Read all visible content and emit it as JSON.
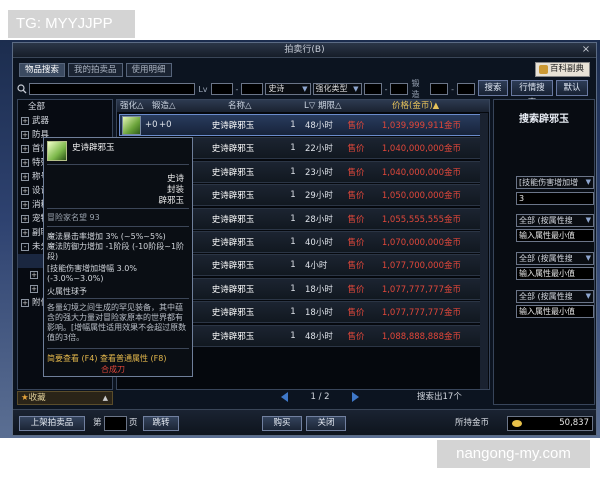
{
  "watermark_top": "TG: MYYJJPP",
  "watermark_bottom": "nangong-my.com",
  "window": {
    "title": "拍卖行(B)",
    "close": "×"
  },
  "tabs": [
    "物品搜索",
    "我的拍卖品",
    "使用明细"
  ],
  "wiki_button": "百科副典",
  "search": {
    "lv_label": "Lv",
    "grade": "史诗",
    "enhance_type": "强化类型",
    "forge_label": "锻造"
  },
  "top_buttons": {
    "search": "搜索",
    "price_search": "行情搜索",
    "default": "默认"
  },
  "categories": {
    "all": "全部",
    "items": [
      "武器",
      "防具",
      "首饰",
      "特殊装备",
      "称号",
      "设计图",
      "消耗品",
      "宠物",
      "副职业",
      "未分类",
      "",
      "",
      "附件"
    ]
  },
  "favorites": "收藏",
  "columns": {
    "enhance": "强化△",
    "forge": "锻造△",
    "name": "名称△",
    "level": "L▽",
    "period": "期限△",
    "price": "价格(金币)▲"
  },
  "rows": [
    {
      "plus1": "+0",
      "plus2": "+0",
      "name": "史诗辟邪玉",
      "level": "1",
      "time": "48小时",
      "tag": "售价",
      "price": "1,039,999,911金币"
    },
    {
      "plus1": "",
      "plus2": "",
      "name": "史诗辟邪玉",
      "level": "1",
      "time": "22小时",
      "tag": "售价",
      "price": "1,040,000,000金币"
    },
    {
      "plus1": "",
      "plus2": "",
      "name": "史诗辟邪玉",
      "level": "1",
      "time": "23小时",
      "tag": "售价",
      "price": "1,040,000,000金币"
    },
    {
      "plus1": "",
      "plus2": "",
      "name": "史诗辟邪玉",
      "level": "1",
      "time": "29小时",
      "tag": "售价",
      "price": "1,050,000,000金币"
    },
    {
      "plus1": "",
      "plus2": "",
      "name": "史诗辟邪玉",
      "level": "1",
      "time": "28小时",
      "tag": "售价",
      "price": "1,055,555,555金币"
    },
    {
      "plus1": "",
      "plus2": "",
      "name": "史诗辟邪玉",
      "level": "1",
      "time": "40小时",
      "tag": "售价",
      "price": "1,070,000,000金币"
    },
    {
      "plus1": "",
      "plus2": "",
      "name": "史诗辟邪玉",
      "level": "1",
      "time": "4小时",
      "tag": "售价",
      "price": "1,077,700,000金币"
    },
    {
      "plus1": "",
      "plus2": "",
      "name": "史诗辟邪玉",
      "level": "1",
      "time": "18小时",
      "tag": "售价",
      "price": "1,077,777,777金币"
    },
    {
      "plus1": "",
      "plus2": "",
      "name": "史诗辟邪玉",
      "level": "1",
      "time": "18小时",
      "tag": "售价",
      "price": "1,077,777,777金币"
    },
    {
      "plus1": "",
      "plus2": "",
      "name": "史诗辟邪玉",
      "level": "1",
      "time": "48小时",
      "tag": "售价",
      "price": "1,088,888,888金币"
    }
  ],
  "pager": {
    "text": "1 / 2"
  },
  "found": "搜索出17个",
  "right_panel": {
    "title": "搜索辟邪玉",
    "filter1": "[技能伤害增加增",
    "value1": "3",
    "attr_select": "全部 (按属性搜",
    "attr_min_ph": "输入属性最小值"
  },
  "tooltip": {
    "name": "史诗辟邪玉",
    "grade": "史诗",
    "bind": "封装",
    "type": "辟邪玉",
    "fame": "冒险家名望 93",
    "attr1": "魔法暴击率增加 3% (~5%~5%)",
    "attr2": "魔法防御力增加 -1阶段 (-10阶段~1阶段)",
    "attr3": "[技能伤害增加增幅 3.0% (-3.0%~3.0%)",
    "attr4": "火属性球予",
    "desc": "各量幻境之间生成的罕见装备，其中蕴含的强大力量对冒险家原本的世界都有影响。[增幅属性适用效果不会超过原数值的3倍。",
    "foot1": "简要查看 (F4) 查看普通属性 (F8)",
    "foot2": "合成刀"
  },
  "bottom": {
    "list_button": "上架拍卖品",
    "page_label": "第",
    "page_suffix": "页",
    "jump": "跳转",
    "buy": "购买",
    "close": "关闭",
    "gold_label": "所持金币",
    "gold_value": "50,837"
  }
}
